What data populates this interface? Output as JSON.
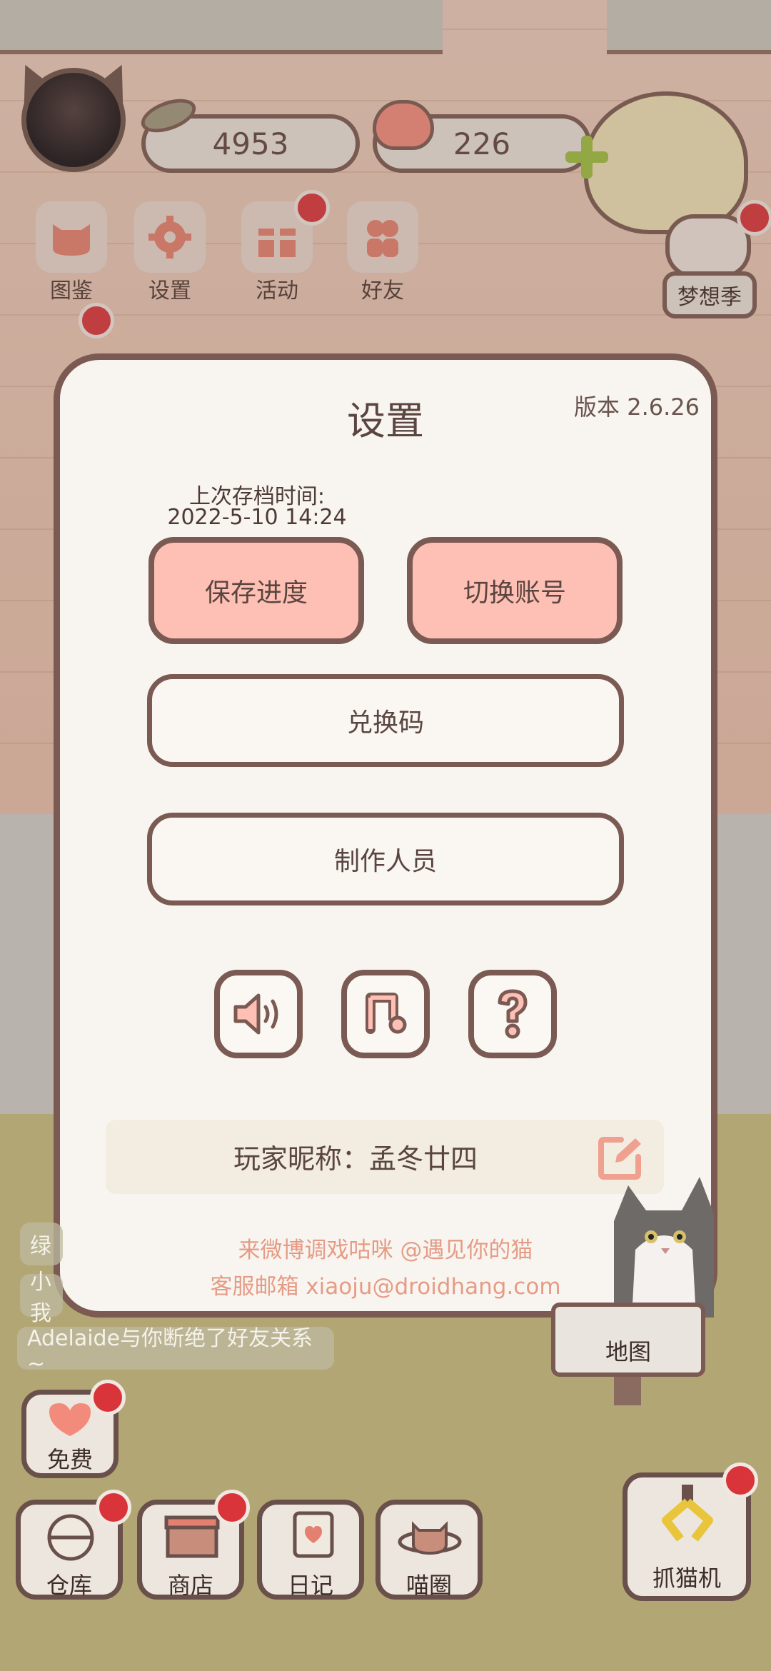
{
  "top_bar": {
    "fish_count": "4953",
    "heart_count": "226",
    "menu": [
      {
        "label": "图鉴",
        "icon": "cat-face-icon"
      },
      {
        "label": "设置",
        "icon": "gear-icon"
      },
      {
        "label": "活动",
        "icon": "gift-icon"
      },
      {
        "label": "好友",
        "icon": "friends-icon"
      }
    ],
    "dream_season": "梦想季"
  },
  "settings": {
    "title": "设置",
    "version": "版本 2.6.26",
    "last_save_label": "上次存档时间:",
    "last_save_time": "2022-5-10 14:24",
    "save_button": "保存进度",
    "switch_account_button": "切换账号",
    "redeem_code_button": "兑换码",
    "credits_button": "制作人员",
    "icons": [
      "sound-icon",
      "music-icon",
      "help-icon"
    ],
    "nickname": "玩家昵称：孟冬廿四",
    "weibo_text": "来微博调戏咕咪 @遇见你的猫",
    "email_text": "客服邮箱 xiaoju@droidhang.com"
  },
  "messages": {
    "partial_1": "绿",
    "partial_2": "小我",
    "friend_removed": "Adelaide与你断绝了好友关系~"
  },
  "bottom": {
    "free": "免费",
    "warehouse": "仓库",
    "shop": "商店",
    "diary": "日记",
    "meow_circle": "喵圈",
    "map": "地图",
    "claw_machine": "抓猫机"
  },
  "colors": {
    "accent_pink": "#fec0b5",
    "border_brown": "#7a5a52",
    "link_salmon": "#e59b85",
    "badge_red": "#d8343a"
  }
}
